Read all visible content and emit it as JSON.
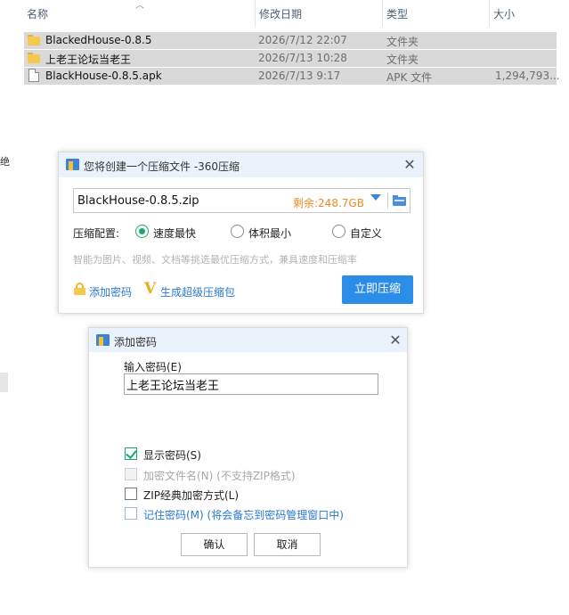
{
  "explorer": {
    "columns": {
      "name": "名称",
      "modified": "修改日期",
      "type": "类型",
      "size": "大小"
    },
    "files": [
      {
        "name": "BlackedHouse-0.8.5",
        "modified": "2026/7/12 22:07",
        "type": "文件夹",
        "size": "",
        "icon": "folder-icon"
      },
      {
        "name": "上老王论坛当老王",
        "modified": "2026/7/13 10:28",
        "type": "文件夹",
        "size": "",
        "icon": "folder-icon"
      },
      {
        "name": "BlackHouse-0.8.5.apk",
        "modified": "2026/7/13 9:17",
        "type": "APK 文件",
        "size": "1,294,793...",
        "icon": "file-icon"
      }
    ],
    "left_fragment": "绝"
  },
  "compress_dialog": {
    "title": "您将创建一个压缩文件 -360压缩",
    "filename": "BlackHouse-0.8.5.zip",
    "free_space": "剩余:248.7GB",
    "config_label": "压缩配置:",
    "options": [
      "速度最快",
      "体积最小",
      "自定义"
    ],
    "selected_option": "速度最快",
    "hint": "智能为图片、视频、文档等挑选最优压缩方式，兼具速度和压缩率",
    "add_password_link": "添加密码",
    "super_package_link": "生成超级压缩包",
    "compress_button": "立即压缩",
    "accent_color": "#2b8de8",
    "free_space_color": "#f08a24"
  },
  "password_dialog": {
    "title": "添加密码",
    "field_label": "输入密码(E)",
    "password_value": "上老王论坛当老王",
    "checkboxes": [
      {
        "label": "显示密码(S)",
        "checked": true,
        "disabled": false
      },
      {
        "label": "加密文件名(N) (不支持ZIP格式)",
        "checked": false,
        "disabled": true
      },
      {
        "label": "ZIP经典加密方式(L)",
        "checked": false,
        "disabled": false
      },
      {
        "label": "记住密码(M) (将会备忘到密码管理窗口中)",
        "checked": false,
        "disabled": false
      }
    ],
    "ok_button": "确认",
    "cancel_button": "取消"
  }
}
